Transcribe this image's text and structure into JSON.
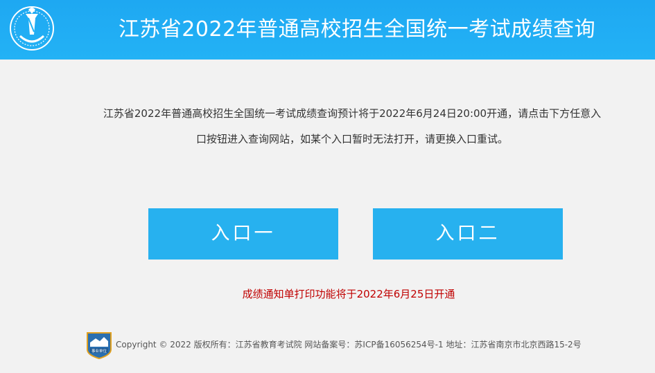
{
  "header": {
    "title": "江苏省2022年普通高校招生全国统一考试成绩查询",
    "logo_icon": "torch-emblem-icon",
    "color": "#23b2f5"
  },
  "intro": {
    "line1": "江苏省2022年普通高校招生全国统一考试成绩查询预计将于2022年6月24日20:00开通，请点击下方任意入",
    "line2": "口按钮进入查询网站，如某个入口暂时无法打开，请更换入口重试。"
  },
  "entries": [
    {
      "label": "入口一"
    },
    {
      "label": "入口二"
    }
  ],
  "entry_color": "#27b1ef",
  "notice": "成绩通知单打印功能将于2022年6月25日开通",
  "notice_color": "#c00000",
  "footer": {
    "badge_icon": "public-institution-badge-icon",
    "badge_text": "事业单位",
    "text": "Copyright © 2022 版权所有：江苏省教育考试院  网站备案号：苏ICP备16056254号-1  地址：江苏省南京市北京西路15-2号"
  }
}
